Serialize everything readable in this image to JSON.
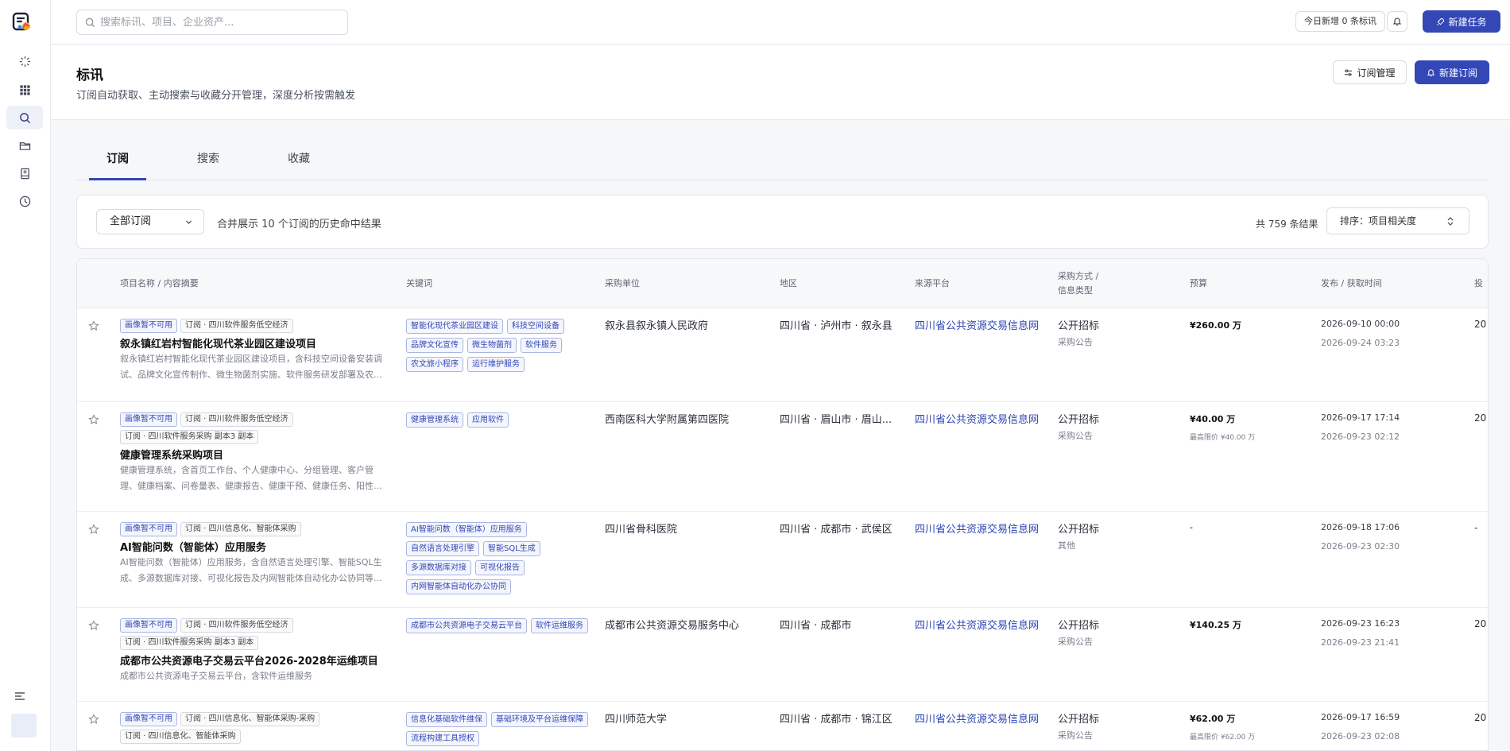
{
  "search": {
    "placeholder": "搜索标讯、项目、企业资产..."
  },
  "header": {
    "today_label": "今日新增 0 条标讯",
    "new_task_label": "新建任务"
  },
  "page": {
    "title": "标讯",
    "subtitle": "订阅自动获取、主动搜索与收藏分开管理，深度分析按需触发",
    "manage_label": "订阅管理",
    "new_sub_label": "新建订阅"
  },
  "tabs": [
    {
      "label": "订阅"
    },
    {
      "label": "搜索"
    },
    {
      "label": "收藏"
    }
  ],
  "filter": {
    "select_label": "全部订阅",
    "description": "合并展示 10 个订阅的历史命中结果",
    "total_label": "共 759 条结果",
    "sort_label": "排序：项目相关度"
  },
  "columns": {
    "name": "项目名称 / 内容摘要",
    "keywords": "关键词",
    "buyer": "采购单位",
    "region": "地区",
    "platform": "来源平台",
    "method_1": "采购方式 /",
    "method_2": "信息类型",
    "budget": "预算",
    "time": "发布 / 获取时间",
    "extra": "投"
  },
  "rows": [
    {
      "tags1": [
        "画像暂不可用",
        "订阅 · 四川软件服务低空经济"
      ],
      "title": "叙永镇红岩村智能化现代茶业园区建设项目",
      "summary": "叙永镇红岩村智能化现代茶业园区建设项目，含科技空间设备安装调试、品牌文化宣传制作、微生物菌剂实施、软件服务研发部署及农...",
      "keywords": [
        "智能化现代茶业园区建设",
        "科技空间设备",
        "品牌文化宣传",
        "微生物菌剂",
        "软件服务",
        "农文旅小程序",
        "运行维护服务"
      ],
      "buyer": "叙永县叙永镇人民政府",
      "region": "四川省 · 泸州市 · 叙永县",
      "platform": "四川省公共资源交易信息网",
      "method": "公开招标",
      "info_type": "采购公告",
      "budget": "¥260.00 万",
      "publish": "2026-09-10 00:00",
      "fetched": "2026-09-24 03:23",
      "extra": "20"
    },
    {
      "tags1": [
        "画像暂不可用",
        "订阅 · 四川软件服务低空经济"
      ],
      "tags2": [
        "订阅 · 四川软件服务采购 副本3 副本"
      ],
      "title": "健康管理系统采购项目",
      "summary": "健康管理系统，含首页工作台、个人健康中心、分组管理、客户管理、健康档案、问卷量表、健康报告、健康干预、健康任务、阳性...",
      "keywords": [
        "健康管理系统",
        "应用软件"
      ],
      "buyer": "西南医科大学附属第四医院",
      "region": "四川省 · 眉山市 · 眉山...",
      "platform": "四川省公共资源交易信息网",
      "method": "公开招标",
      "info_type": "采购公告",
      "budget": "¥40.00 万",
      "cap": "最高限价 ¥40.00 万",
      "publish": "2026-09-17 17:14",
      "fetched": "2026-09-23 02:12",
      "extra": "20"
    },
    {
      "tags1": [
        "画像暂不可用",
        "订阅 · 四川信息化、智能体采购"
      ],
      "title": "AI智能问数（智能体）应用服务",
      "summary": "AI智能问数（智能体）应用服务，含自然语言处理引擎、智能SQL生成、多源数据库对接、可视化报告及内网智能体自动化办公协同等...",
      "keywords": [
        "AI智能问数（智能体）应用服务",
        "自然语言处理引擎",
        "智能SQL生成",
        "多源数据库对接",
        "可视化报告",
        "内网智能体自动化办公协同"
      ],
      "buyer": "四川省骨科医院",
      "region": "四川省 · 成都市 · 武侯区",
      "platform": "四川省公共资源交易信息网",
      "method": "公开招标",
      "info_type": "其他",
      "budget": "-",
      "publish": "2026-09-18 17:06",
      "fetched": "2026-09-23 02:30",
      "extra": "-"
    },
    {
      "tags1": [
        "画像暂不可用",
        "订阅 · 四川软件服务低空经济"
      ],
      "tags2": [
        "订阅 · 四川软件服务采购 副本3 副本"
      ],
      "title": "成都市公共资源电子交易云平台2026-2028年运维项目",
      "summary": "成都市公共资源电子交易云平台，含软件运维服务",
      "keywords": [
        "成都市公共资源电子交易云平台",
        "软件运维服务"
      ],
      "buyer": "成都市公共资源交易服务中心",
      "region": "四川省 · 成都市",
      "platform": "四川省公共资源交易信息网",
      "method": "公开招标",
      "info_type": "采购公告",
      "budget": "¥140.25 万",
      "publish": "2026-09-23 16:23",
      "fetched": "2026-09-23 21:41",
      "extra": "20"
    },
    {
      "tags1": [
        "画像暂不可用",
        "订阅 · 四川信息化、智能体采购-采购"
      ],
      "tags2": [
        "订阅 · 四川信息化、智能体采购"
      ],
      "keywords": [
        "信息化基础软件维保",
        "基础环境及平台运维保障",
        "流程构建工具授权"
      ],
      "buyer": "四川师范大学",
      "region": "四川省 · 成都市 · 锦江区",
      "platform": "四川省公共资源交易信息网",
      "method": "公开招标",
      "info_type": "采购公告",
      "budget": "¥62.00 万",
      "cap": "最高限价 ¥62.00 万",
      "publish": "2026-09-17 16:59",
      "fetched": "2026-09-23 02:08",
      "extra": "20"
    }
  ]
}
